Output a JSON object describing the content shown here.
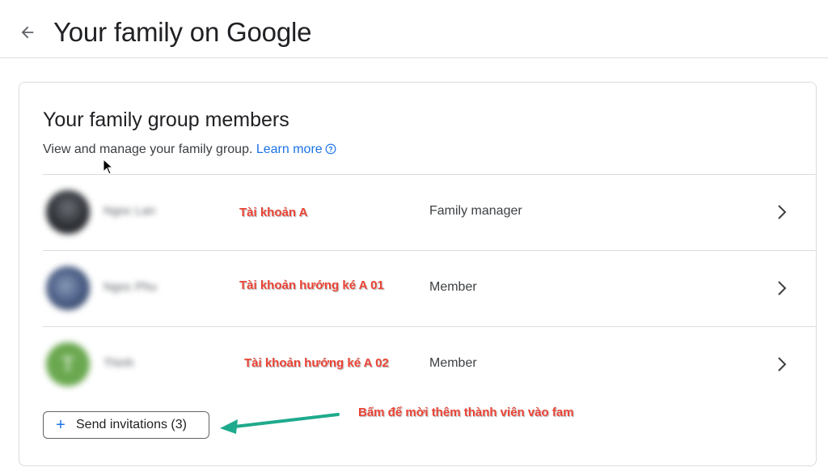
{
  "header": {
    "back_icon": "arrow-back-icon",
    "title": "Your family on Google"
  },
  "card": {
    "title": "Your family group members",
    "description": "View and manage your family group.",
    "learn_more": "Learn more",
    "help_icon": "help-circle-icon"
  },
  "members": [
    {
      "name": "Ngoc Lan",
      "role": "Family manager",
      "annotation": "Tài khoản A",
      "avatar_color": "#2d3035"
    },
    {
      "name": "Ngoc Phu",
      "role": "Member",
      "annotation": "Tài khoản hướng ké A 01",
      "avatar_color": "#4a5d85"
    },
    {
      "name": "Thinh",
      "role": "Member",
      "annotation": "Tài khoản hướng ké A 02",
      "avatar_color": "#6aa84f",
      "avatar_letter": "T"
    }
  ],
  "invite": {
    "label": "Send invitations (3)",
    "icon": "plus-icon",
    "annotation": "Bấm để mời thêm thành viên vào fam"
  },
  "colors": {
    "accent": "#1a73e8",
    "annotation_red": "#ea4335",
    "annotation_arrow": "#1eaa8c",
    "divider": "#dadce0"
  }
}
